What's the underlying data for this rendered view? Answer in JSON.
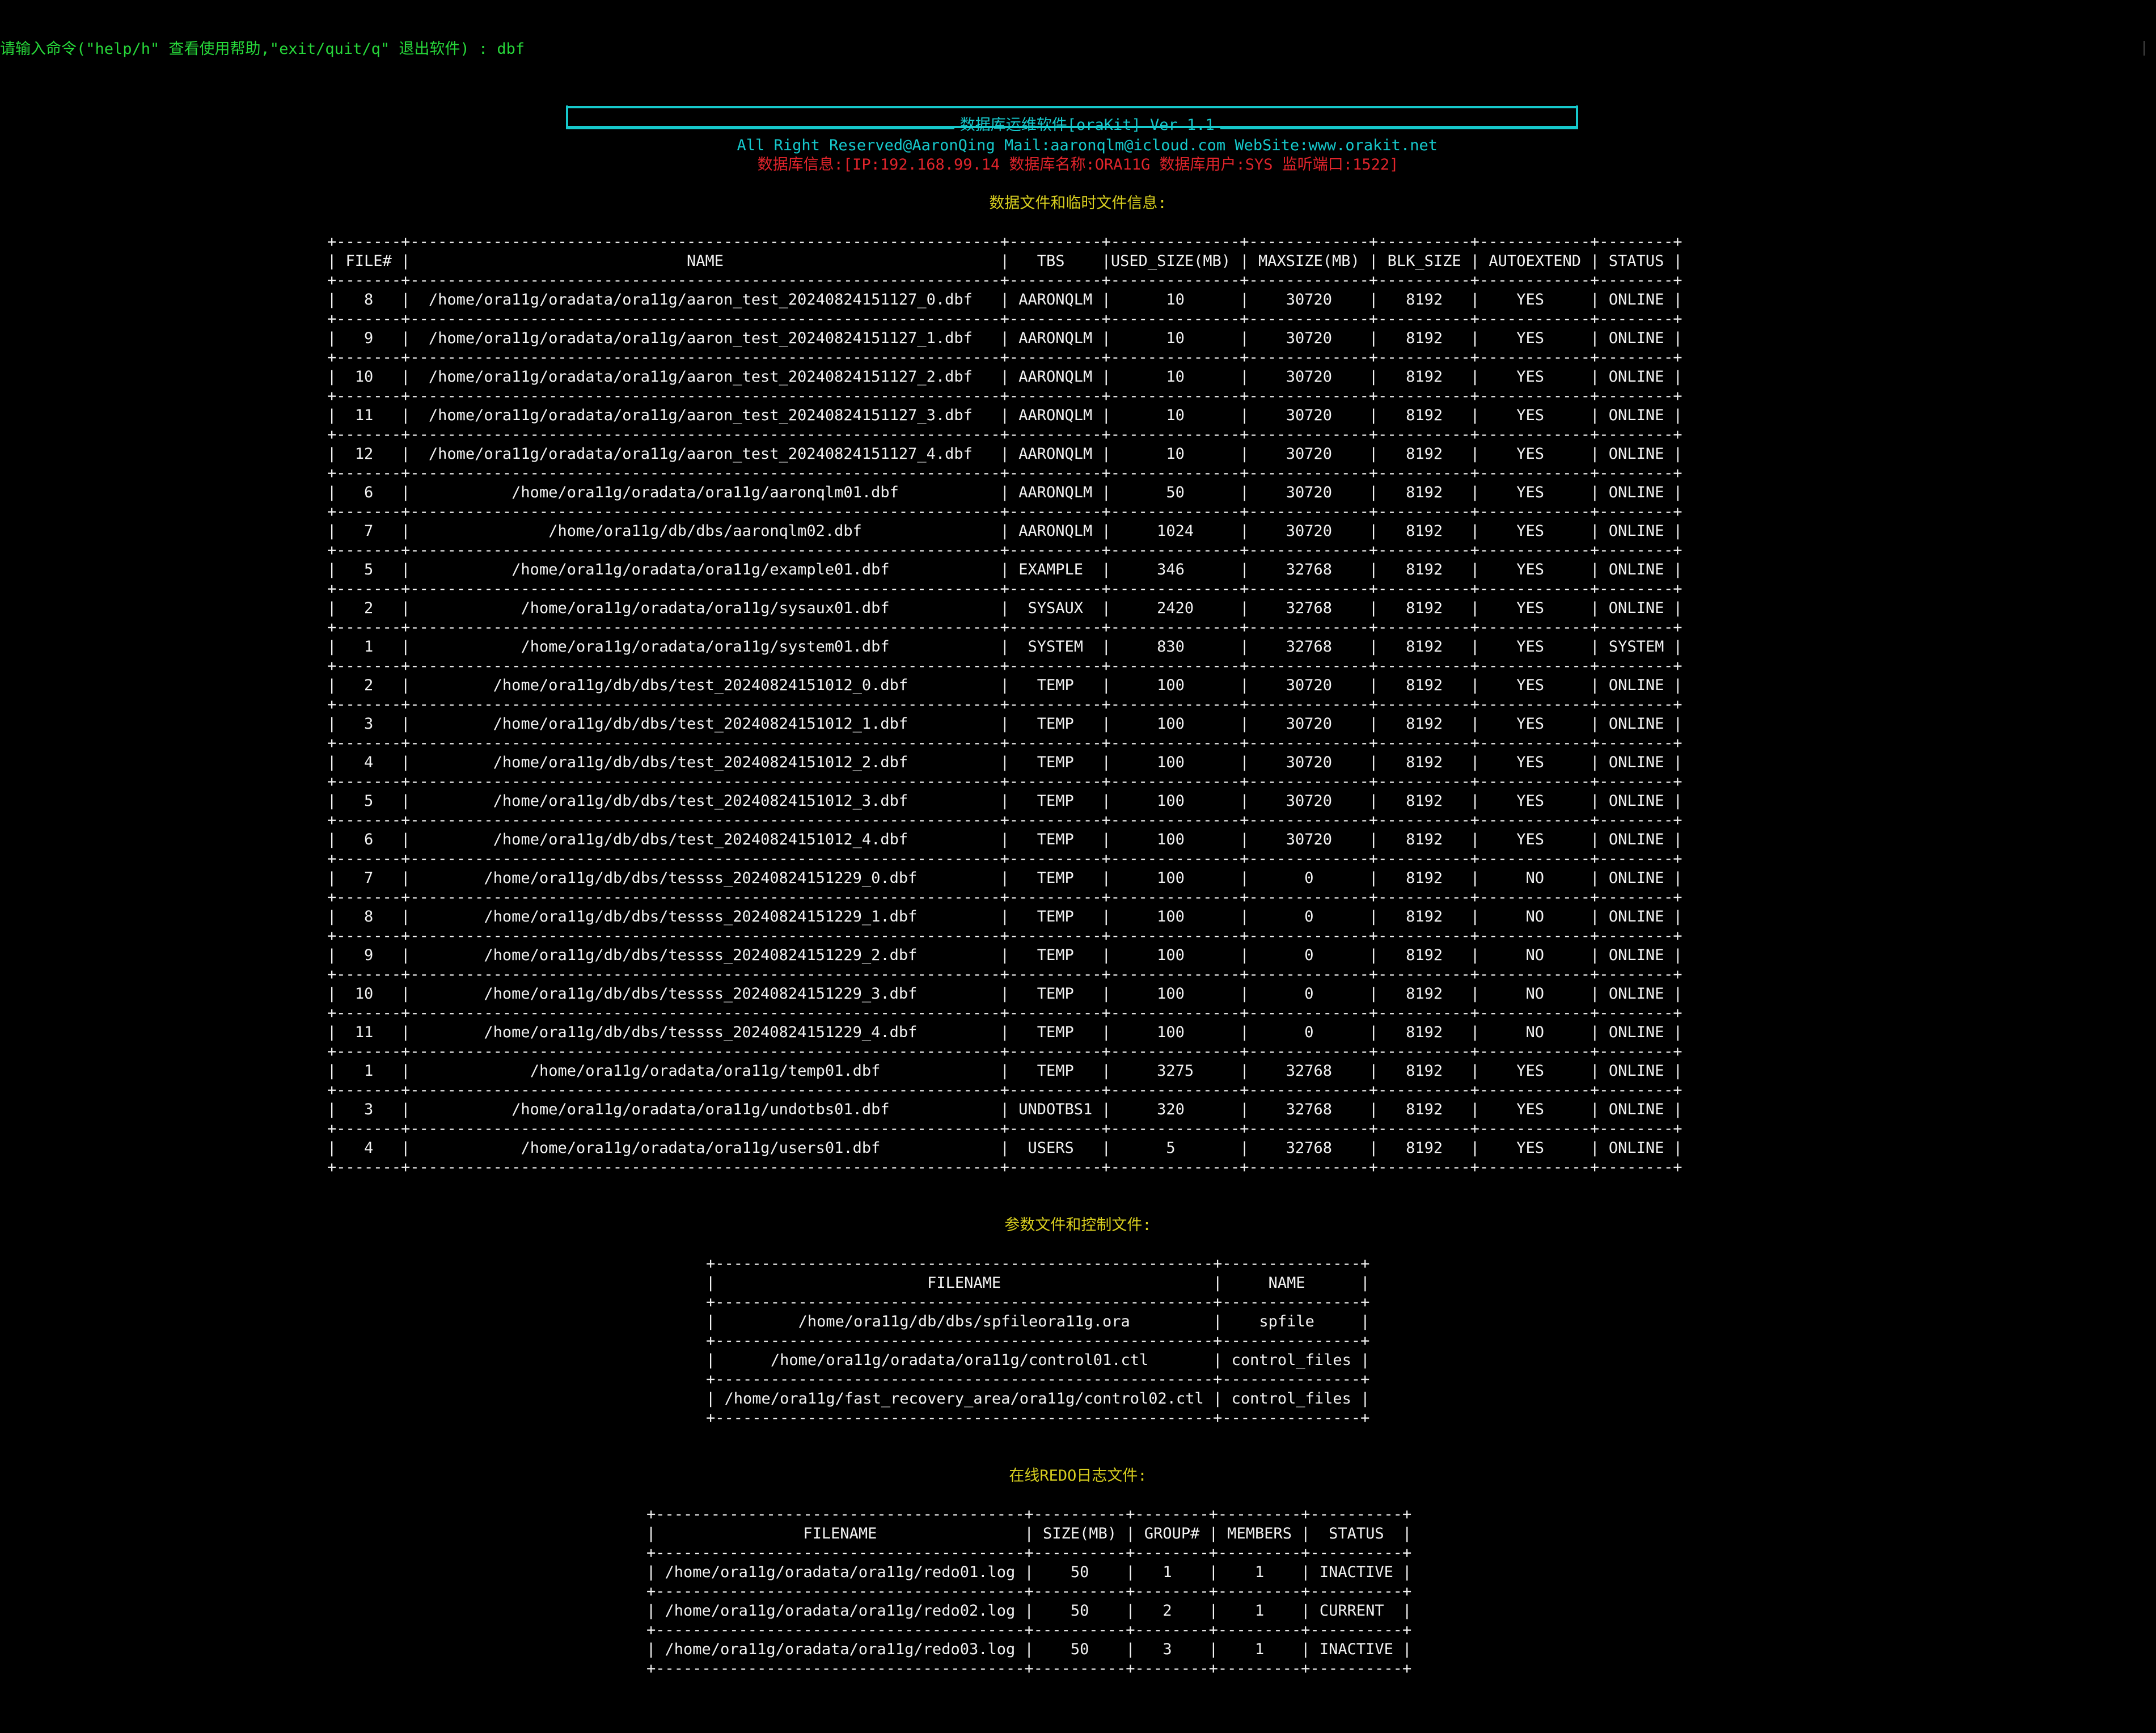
{
  "prompt": {
    "text": "请输入命令(\"help/h\" 查看使用帮助,\"exit/quit/q\" 退出软件) : dbf"
  },
  "banner": {
    "title": "数据库运维软件[oraKit] Ver 1.1",
    "subtitle": "All Right Reserved@AaronQing Mail:aaronqlm@icloud.com WebSite:www.orakit.net"
  },
  "db_info": {
    "text": "数据库信息:[IP:192.168.99.14 数据库名称:ORA11G 数据库用户:SYS 监听端口:1522]"
  },
  "datafiles": {
    "section_title": "数据文件和临时文件信息:",
    "columns": [
      "FILE#",
      "NAME",
      "TBS",
      "USED_SIZE(MB)",
      "MAXSIZE(MB)",
      "BLK_SIZE",
      "AUTOEXTEND",
      "STATUS"
    ],
    "rows": [
      [
        "8",
        "/home/ora11g/oradata/ora11g/aaron_test_20240824151127_0.dbf",
        "AARONQLM",
        "10",
        "30720",
        "8192",
        "YES",
        "ONLINE"
      ],
      [
        "9",
        "/home/ora11g/oradata/ora11g/aaron_test_20240824151127_1.dbf",
        "AARONQLM",
        "10",
        "30720",
        "8192",
        "YES",
        "ONLINE"
      ],
      [
        "10",
        "/home/ora11g/oradata/ora11g/aaron_test_20240824151127_2.dbf",
        "AARONQLM",
        "10",
        "30720",
        "8192",
        "YES",
        "ONLINE"
      ],
      [
        "11",
        "/home/ora11g/oradata/ora11g/aaron_test_20240824151127_3.dbf",
        "AARONQLM",
        "10",
        "30720",
        "8192",
        "YES",
        "ONLINE"
      ],
      [
        "12",
        "/home/ora11g/oradata/ora11g/aaron_test_20240824151127_4.dbf",
        "AARONQLM",
        "10",
        "30720",
        "8192",
        "YES",
        "ONLINE"
      ],
      [
        "6",
        "/home/ora11g/oradata/ora11g/aaronqlm01.dbf",
        "AARONQLM",
        "50",
        "30720",
        "8192",
        "YES",
        "ONLINE"
      ],
      [
        "7",
        "/home/ora11g/db/dbs/aaronqlm02.dbf",
        "AARONQLM",
        "1024",
        "30720",
        "8192",
        "YES",
        "ONLINE"
      ],
      [
        "5",
        "/home/ora11g/oradata/ora11g/example01.dbf",
        "EXAMPLE",
        "346",
        "32768",
        "8192",
        "YES",
        "ONLINE"
      ],
      [
        "2",
        "/home/ora11g/oradata/ora11g/sysaux01.dbf",
        "SYSAUX",
        "2420",
        "32768",
        "8192",
        "YES",
        "ONLINE"
      ],
      [
        "1",
        "/home/ora11g/oradata/ora11g/system01.dbf",
        "SYSTEM",
        "830",
        "32768",
        "8192",
        "YES",
        "SYSTEM"
      ],
      [
        "2",
        "/home/ora11g/db/dbs/test_20240824151012_0.dbf",
        "TEMP",
        "100",
        "30720",
        "8192",
        "YES",
        "ONLINE"
      ],
      [
        "3",
        "/home/ora11g/db/dbs/test_20240824151012_1.dbf",
        "TEMP",
        "100",
        "30720",
        "8192",
        "YES",
        "ONLINE"
      ],
      [
        "4",
        "/home/ora11g/db/dbs/test_20240824151012_2.dbf",
        "TEMP",
        "100",
        "30720",
        "8192",
        "YES",
        "ONLINE"
      ],
      [
        "5",
        "/home/ora11g/db/dbs/test_20240824151012_3.dbf",
        "TEMP",
        "100",
        "30720",
        "8192",
        "YES",
        "ONLINE"
      ],
      [
        "6",
        "/home/ora11g/db/dbs/test_20240824151012_4.dbf",
        "TEMP",
        "100",
        "30720",
        "8192",
        "YES",
        "ONLINE"
      ],
      [
        "7",
        "/home/ora11g/db/dbs/tessss_20240824151229_0.dbf",
        "TEMP",
        "100",
        "0",
        "8192",
        "NO",
        "ONLINE"
      ],
      [
        "8",
        "/home/ora11g/db/dbs/tessss_20240824151229_1.dbf",
        "TEMP",
        "100",
        "0",
        "8192",
        "NO",
        "ONLINE"
      ],
      [
        "9",
        "/home/ora11g/db/dbs/tessss_20240824151229_2.dbf",
        "TEMP",
        "100",
        "0",
        "8192",
        "NO",
        "ONLINE"
      ],
      [
        "10",
        "/home/ora11g/db/dbs/tessss_20240824151229_3.dbf",
        "TEMP",
        "100",
        "0",
        "8192",
        "NO",
        "ONLINE"
      ],
      [
        "11",
        "/home/ora11g/db/dbs/tessss_20240824151229_4.dbf",
        "TEMP",
        "100",
        "0",
        "8192",
        "NO",
        "ONLINE"
      ],
      [
        "1",
        "/home/ora11g/oradata/ora11g/temp01.dbf",
        "TEMP",
        "3275",
        "32768",
        "8192",
        "YES",
        "ONLINE"
      ],
      [
        "3",
        "/home/ora11g/oradata/ora11g/undotbs01.dbf",
        "UNDOTBS1",
        "320",
        "32768",
        "8192",
        "YES",
        "ONLINE"
      ],
      [
        "4",
        "/home/ora11g/oradata/ora11g/users01.dbf",
        "USERS",
        "5",
        "32768",
        "8192",
        "YES",
        "ONLINE"
      ]
    ]
  },
  "paramfiles": {
    "section_title": "参数文件和控制文件:",
    "columns": [
      "FILENAME",
      "NAME"
    ],
    "rows": [
      [
        "/home/ora11g/db/dbs/spfileora11g.ora",
        "spfile"
      ],
      [
        "/home/ora11g/oradata/ora11g/control01.ctl",
        "control_files"
      ],
      [
        "/home/ora11g/fast_recovery_area/ora11g/control02.ctl",
        "control_files"
      ]
    ]
  },
  "redologs": {
    "section_title": "在线REDO日志文件:",
    "columns": [
      "FILENAME",
      "SIZE(MB)",
      "GROUP#",
      "MEMBERS",
      "STATUS"
    ],
    "rows": [
      [
        "/home/ora11g/oradata/ora11g/redo01.log",
        "50",
        "1",
        "1",
        "INACTIVE"
      ],
      [
        "/home/ora11g/oradata/ora11g/redo02.log",
        "50",
        "2",
        "1",
        "CURRENT"
      ],
      [
        "/home/ora11g/oradata/ora11g/redo03.log",
        "50",
        "3",
        "1",
        "INACTIVE"
      ]
    ]
  },
  "colors": {
    "background": "#000000",
    "prompt": "#27d83a",
    "banner": "#16c9cc",
    "db_info": "#e0242b",
    "section_title": "#d9cf1f",
    "table_text": "#f2f2f2"
  }
}
